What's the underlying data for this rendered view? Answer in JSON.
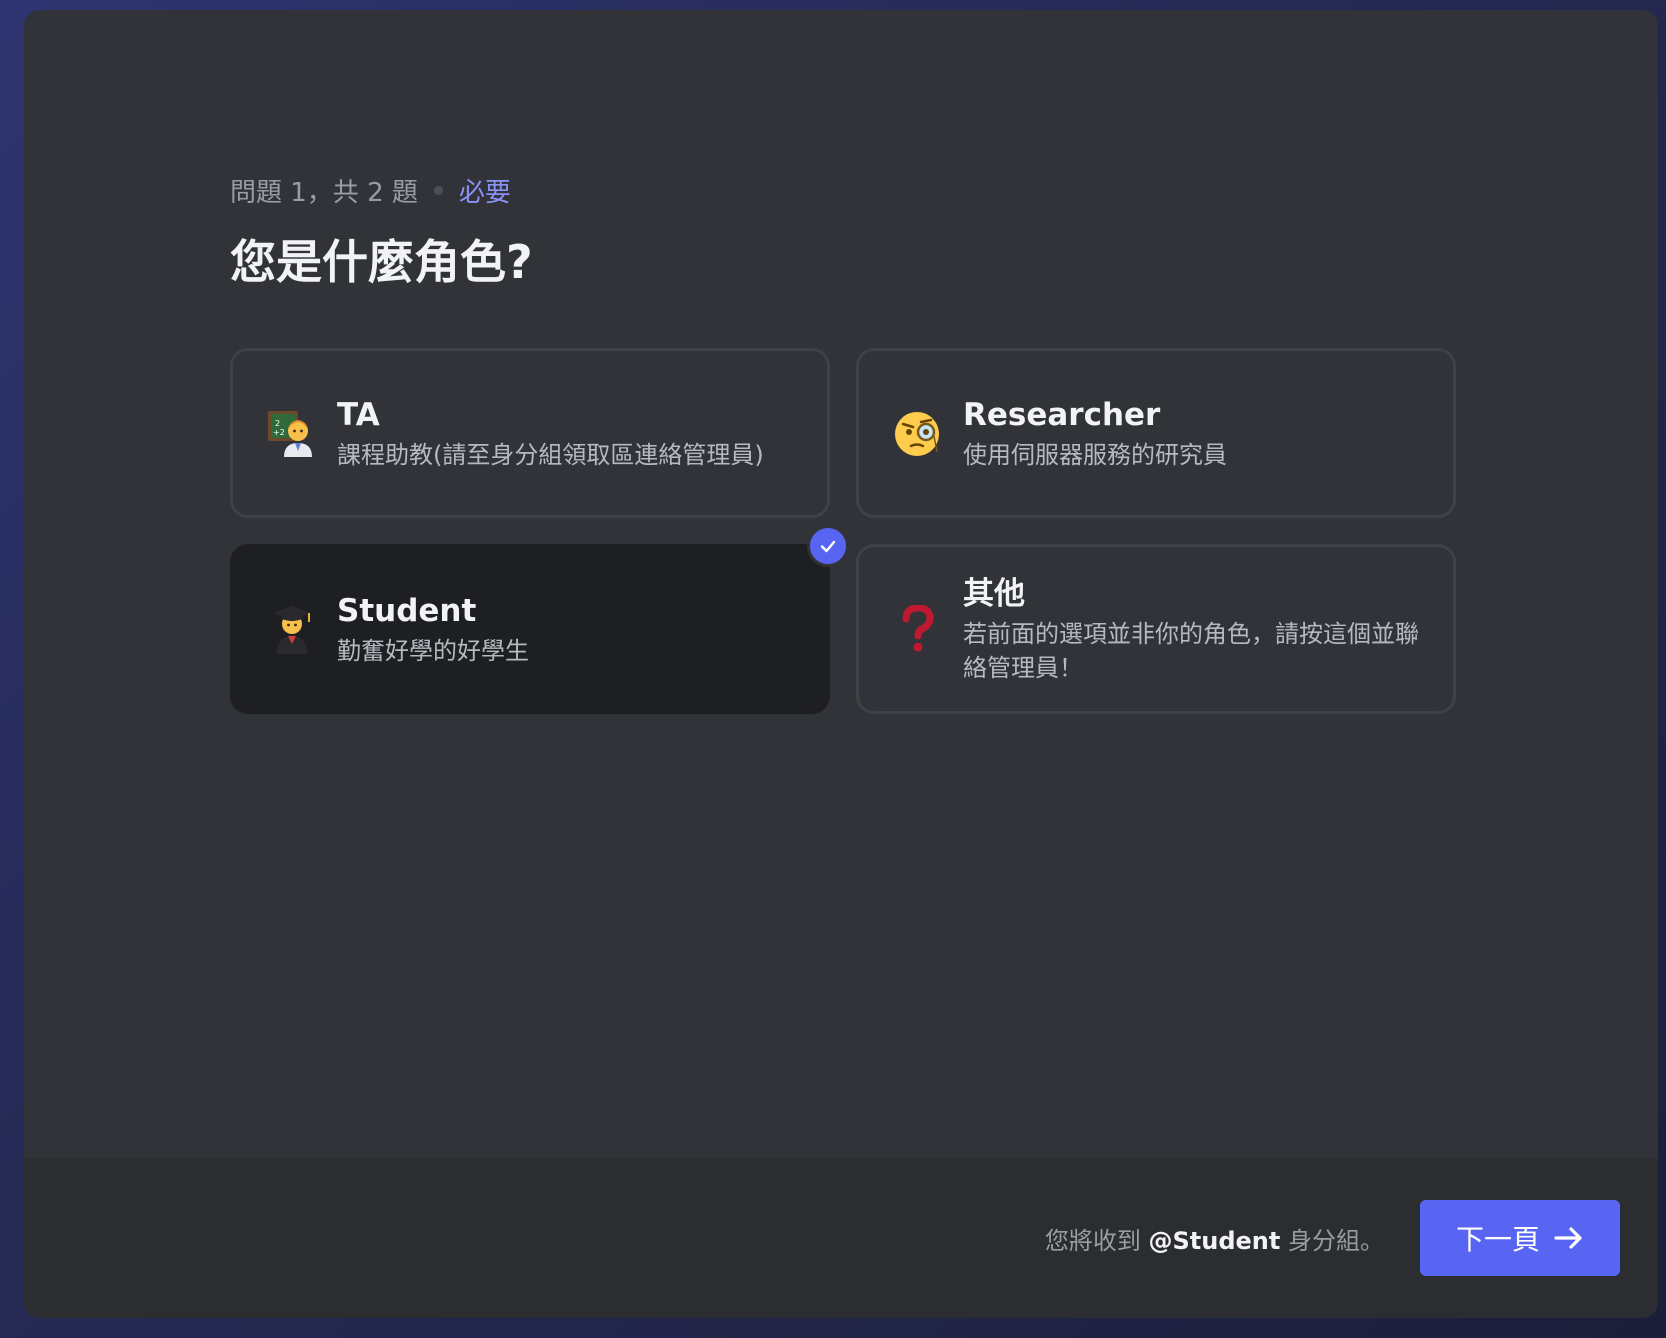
{
  "question": {
    "progress": "問題 1，共 2 題",
    "required": "必要",
    "title": "您是什麼角色?"
  },
  "options": [
    {
      "name": "TA",
      "description": "課程助教(請至身分組領取區連絡管理員)",
      "icon": "teacher-icon",
      "selected": false
    },
    {
      "name": "Researcher",
      "description": "使用伺服器服務的研究員",
      "icon": "face-with-monocle-icon",
      "selected": false
    },
    {
      "name": "Student",
      "description": "勤奮好學的好學生",
      "icon": "student-icon",
      "selected": true
    },
    {
      "name": "其他",
      "description": "若前面的選項並非你的角色，請按這個並聯絡管理員！",
      "icon": "question-mark-icon",
      "selected": false
    }
  ],
  "footer": {
    "note_prefix": "您將收到",
    "note_role": "@Student",
    "note_suffix": "身分組。",
    "next_label": "下一頁"
  },
  "colors": {
    "accent": "#5865f2",
    "modal_bg": "#313338",
    "selected_bg": "#1e1f22"
  }
}
